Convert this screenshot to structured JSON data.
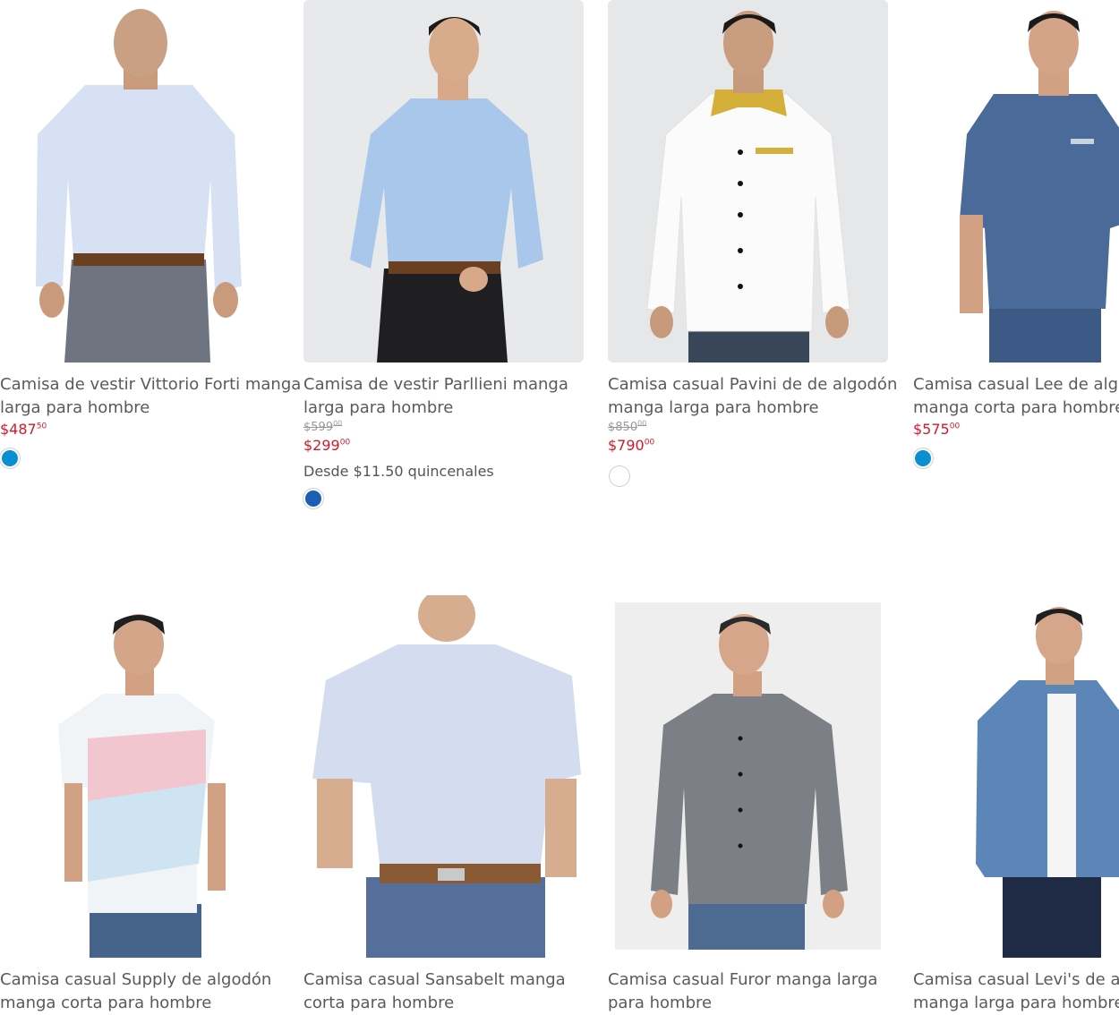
{
  "products": [
    {
      "title_line1": "Camisa de vestir Vittorio Forti manga",
      "title_line2": "larga para hombre",
      "price_main": "$487",
      "price_cents": "50",
      "swatch_color": "#0a8fd0"
    },
    {
      "title_line1": "Camisa de vestir Parllieni manga",
      "title_line2": "larga para hombre",
      "old_price_main": "$599",
      "old_price_cents": "00",
      "price_main": "$299",
      "price_cents": "00",
      "installments": "Desde $11.50 quincenales",
      "swatch_color": "#1a5fb4"
    },
    {
      "title_line1": "Camisa casual Pavini de de algodón",
      "title_line2": "manga larga para hombre",
      "old_price_main": "$850",
      "old_price_cents": "00",
      "price_main": "$790",
      "price_cents": "00",
      "swatch_color": "#ffffff"
    },
    {
      "title_line1": "Camisa casual Lee de algod",
      "title_line2": "manga corta para hombre",
      "price_main": "$575",
      "price_cents": "00",
      "swatch_color": "#0a8fd0"
    },
    {
      "title_line1": "Camisa casual Supply de algodón",
      "title_line2": "manga corta para hombre"
    },
    {
      "title_line1": "Camisa casual Sansabelt manga",
      "title_line2": "corta para hombre"
    },
    {
      "title_line1": "Camisa casual Furor manga larga",
      "title_line2": "para hombre"
    },
    {
      "title_line1": "Camisa casual Levi's de alg",
      "title_line2": "manga larga para hombre"
    }
  ],
  "colors": {
    "price_red": "#d11a2a",
    "text_grey": "#5a5a5a"
  }
}
